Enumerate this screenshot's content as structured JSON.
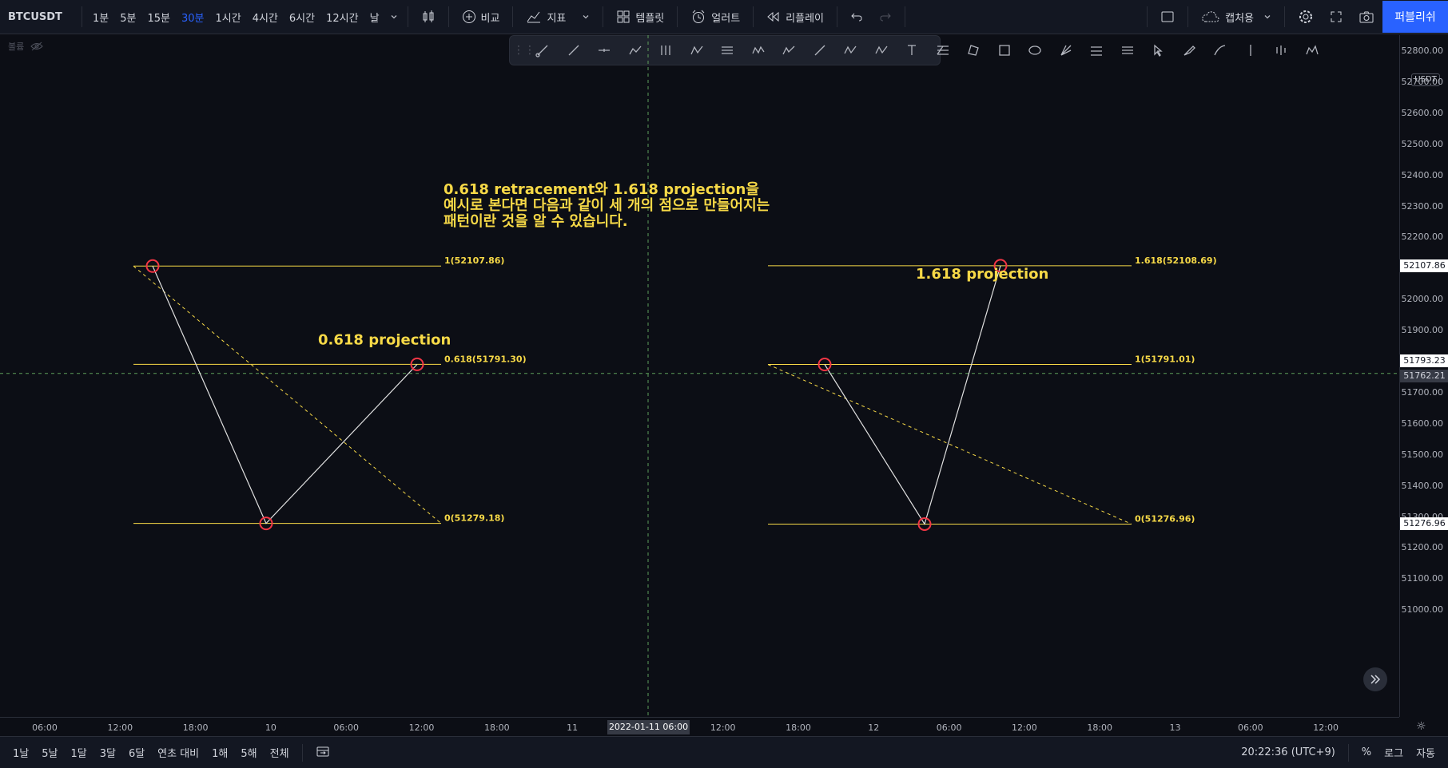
{
  "header": {
    "symbol": "BTCUSDT",
    "timeframes": [
      "1분",
      "5분",
      "15분",
      "30분",
      "1시간",
      "4시간",
      "6시간",
      "12시간",
      "날"
    ],
    "active_timeframe_index": 3,
    "compare_label": "비교",
    "indicators_label": "지표",
    "templates_label": "템플릿",
    "alert_label": "얼러트",
    "replay_label": "리플레이",
    "layout_label": "캡처용",
    "publish_label": "퍼블리쉬"
  },
  "volume_label": "볼륨",
  "drawing_tools": [
    "trend-line-icon",
    "ray-icon",
    "horizontal-ray-icon",
    "path-icon",
    "pitchfork-icon",
    "abcd-pattern-icon",
    "parallel-channel-icon",
    "wxyz-pattern-icon",
    "elliott-wave-icon",
    "line-tool-icon",
    "wxy-pattern-icon",
    "ae-pattern-icon",
    "text-icon",
    "fib-retracement-icon",
    "xabcd-pattern-icon",
    "rectangle-icon",
    "ellipse-icon",
    "gann-fan-icon",
    "fib-channel-icon",
    "regression-icon",
    "cursor-icon",
    "brush-icon",
    "highlighter-icon",
    "vertical-line-icon",
    "bars-pattern-icon",
    "head-shoulders-icon"
  ],
  "annotation": {
    "text": "0.618 retracement와 1.618 projection을\n예시로 본다면 다음과 같이 세 개의 점으로 만들어지는\n패턴이란 것을 알 수 있습니다."
  },
  "left_pattern": {
    "title": "0.618 projection",
    "levels": [
      {
        "label": "1(52107.86)",
        "price": 52107.86
      },
      {
        "label": "0.618(51791.30)",
        "price": 51791.3
      },
      {
        "label": "0(51279.18)",
        "price": 51279.18
      }
    ],
    "points": [
      52107.86,
      51279.18,
      51791.3
    ]
  },
  "right_pattern": {
    "title": "1.618 projection",
    "levels": [
      {
        "label": "1.618(52108.69)",
        "price": 52108.69
      },
      {
        "label": "1(51791.01)",
        "price": 51791.01
      },
      {
        "label": "0(51276.96)",
        "price": 51276.96
      }
    ],
    "points": [
      51791.01,
      51276.96,
      52108.69
    ]
  },
  "price_axis": {
    "currency": "USDT",
    "ticks": [
      "52800.00",
      "52700.00",
      "52600.00",
      "52500.00",
      "52400.00",
      "52300.00",
      "52200.00",
      "52100.00",
      "52000.00",
      "51900.00",
      "51800.00",
      "51700.00",
      "51600.00",
      "51500.00",
      "51400.00",
      "51300.00",
      "51200.00",
      "51100.00",
      "51000.00"
    ],
    "labels": [
      {
        "text": "52107.86",
        "style": "white"
      },
      {
        "text": "51793.23",
        "style": "white"
      },
      {
        "text": "51762.21",
        "style": "dark"
      },
      {
        "text": "51276.96",
        "style": "white"
      }
    ]
  },
  "time_axis": {
    "ticks": [
      "06:00",
      "12:00",
      "18:00",
      "10",
      "06:00",
      "12:00",
      "18:00",
      "11",
      "06:00",
      "12:00",
      "18:00",
      "12",
      "06:00",
      "12:00",
      "18:00",
      "13",
      "06:00",
      "12:00"
    ],
    "crosshair_label": "2022-01-11  06:00"
  },
  "bottom": {
    "ranges": [
      "1날",
      "5날",
      "1달",
      "3달",
      "6달",
      "연초 대비",
      "1해",
      "5해",
      "전체"
    ],
    "clock": "20:22:36 (UTC+9)",
    "percent_label": "%",
    "log_label": "로그",
    "auto_label": "자동"
  },
  "colors": {
    "background": "#0c0e15",
    "level_line": "#f7d947",
    "pattern_line": "#e0e0e0",
    "point_circle": "#f23645",
    "crosshair": "#5d9e5a",
    "accent": "#2962ff"
  }
}
